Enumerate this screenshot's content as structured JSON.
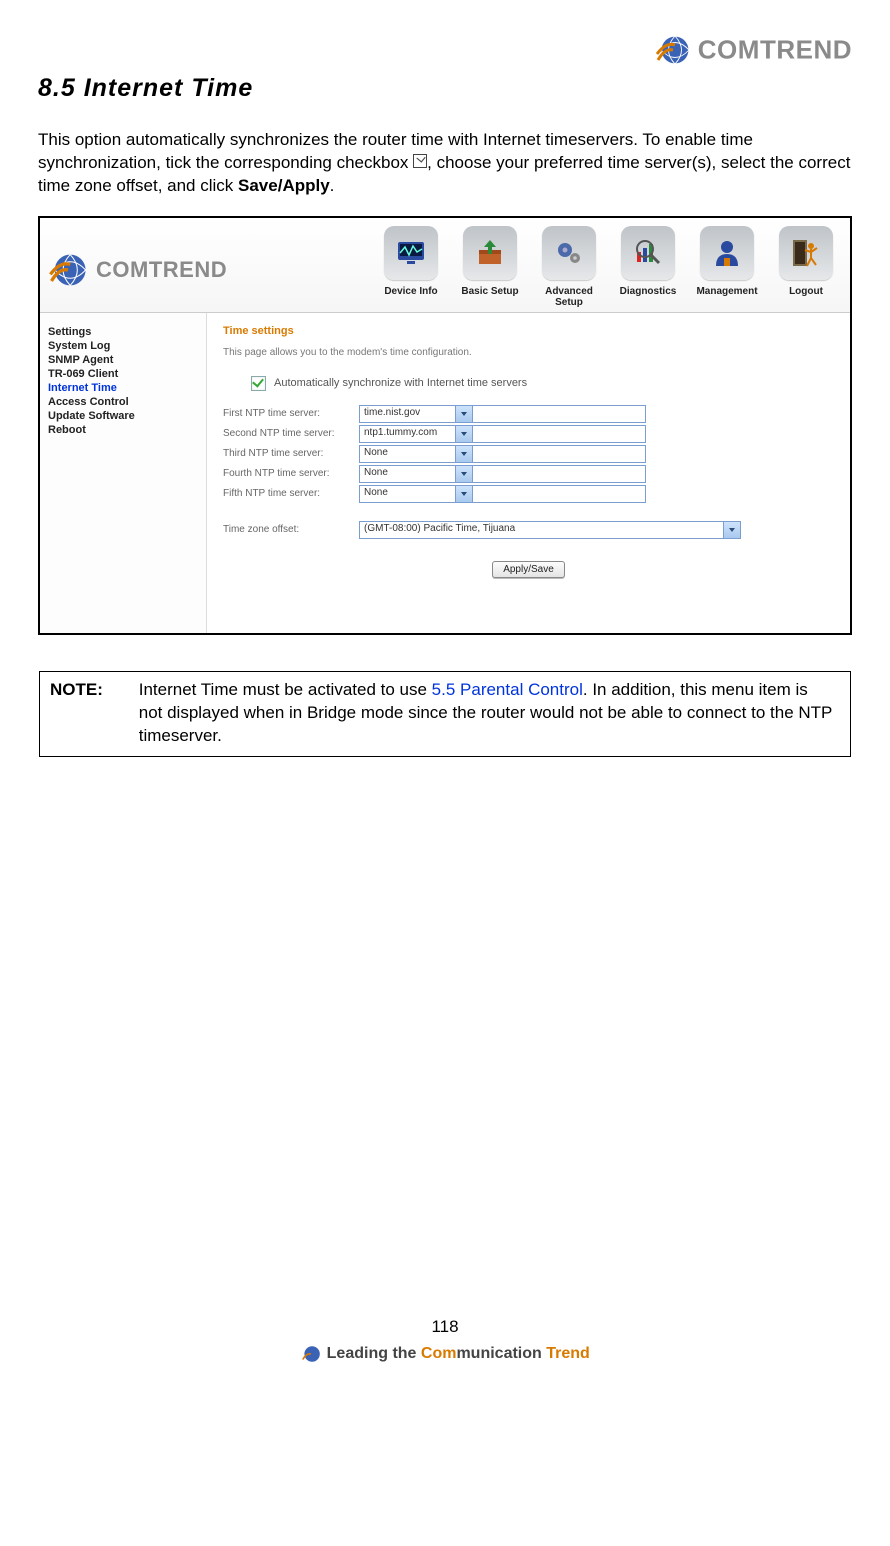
{
  "brand": "COMTREND",
  "page": {
    "heading": "8.5 Internet Time",
    "intro_1": "This option automatically synchronizes the router time with Internet timeservers. To enable time synchronization, tick the corresponding checkbox ",
    "intro_2": ", choose your preferred time server(s), select the correct time zone offset, and click ",
    "intro_bold": "Save/Apply",
    "intro_3": "."
  },
  "nav": [
    {
      "label": "Device Info"
    },
    {
      "label": "Basic Setup"
    },
    {
      "label": "Advanced Setup"
    },
    {
      "label": "Diagnostics"
    },
    {
      "label": "Management"
    },
    {
      "label": "Logout"
    }
  ],
  "sidebar": [
    {
      "label": "Settings",
      "active": false
    },
    {
      "label": "System Log",
      "active": false
    },
    {
      "label": "SNMP Agent",
      "active": false
    },
    {
      "label": "TR-069 Client",
      "active": false
    },
    {
      "label": "Internet Time",
      "active": true
    },
    {
      "label": "Access Control",
      "active": false
    },
    {
      "label": "Update Software",
      "active": false
    },
    {
      "label": "Reboot",
      "active": false
    }
  ],
  "main": {
    "title": "Time settings",
    "subtitle": "This page allows you to the modem's time configuration.",
    "sync_label": "Automatically synchronize with Internet time servers",
    "rows": [
      {
        "label": "First NTP time server:",
        "value": "time.nist.gov"
      },
      {
        "label": "Second NTP time server:",
        "value": "ntp1.tummy.com"
      },
      {
        "label": "Third NTP time server:",
        "value": "None"
      },
      {
        "label": "Fourth NTP time server:",
        "value": "None"
      },
      {
        "label": "Fifth NTP time server:",
        "value": "None"
      }
    ],
    "tz_label": "Time zone offset:",
    "tz_value": "(GMT-08:00) Pacific Time, Tijuana",
    "button": "Apply/Save"
  },
  "note": {
    "label": "NOTE:",
    "t1": "Internet Time must be activated to use ",
    "link": "5.5 Parental Control",
    "t2": ". In addition, this menu item is not displayed when in Bridge mode since the router would not be able to connect to the NTP timeserver."
  },
  "footer": {
    "page_num": "118",
    "tag_1": "Leading the ",
    "tag_orange": "Com",
    "tag_2": "munication ",
    "tag_orange2": "Trend"
  }
}
